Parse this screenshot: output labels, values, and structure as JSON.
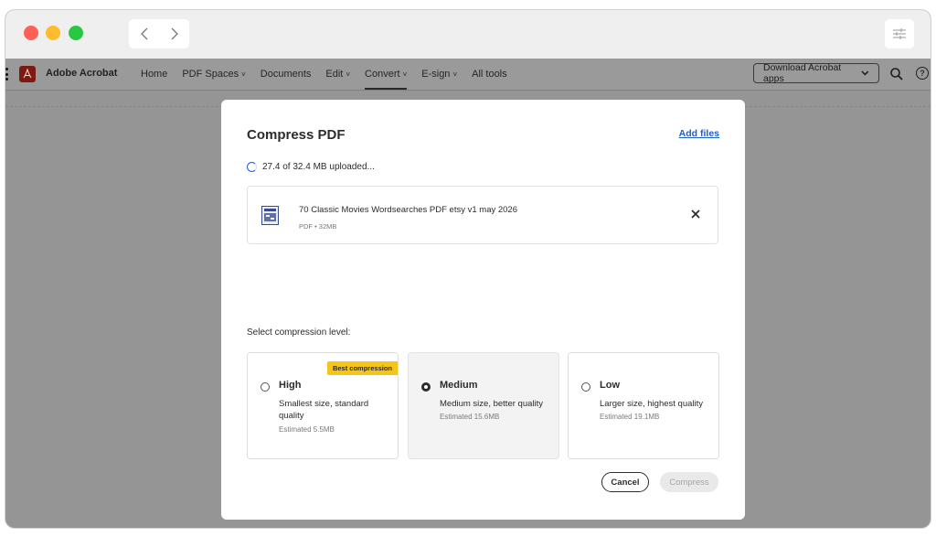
{
  "app": {
    "name": "Adobe Acrobat",
    "menu": [
      {
        "label": "Home",
        "caret": ""
      },
      {
        "label": "PDF Spaces",
        "caret": "˅"
      },
      {
        "label": "Documents",
        "caret": ""
      },
      {
        "label": "Edit",
        "caret": "˅"
      },
      {
        "label": "Convert",
        "caret": "˅"
      },
      {
        "label": "E-sign",
        "caret": "˅"
      },
      {
        "label": "All tools",
        "caret": ""
      }
    ],
    "active_menu": "Convert",
    "download_label": "Download Acrobat apps",
    "help_glyph": "?"
  },
  "modal": {
    "title": "Compress PDF",
    "add_files": "Add files",
    "upload_status": "27.4 of 32.4 MB uploaded...",
    "file": {
      "name": "70 Classic Movies Wordsearches PDF etsy v1 may 2026",
      "meta": "PDF • 32MB"
    },
    "level_label": "Select compression level:",
    "options": [
      {
        "title": "High",
        "desc": "Smallest size, standard quality",
        "estimate": "Estimated 5.5MB",
        "badge": "Best compression",
        "selected": false
      },
      {
        "title": "Medium",
        "desc": "Medium size, better quality",
        "estimate": "Estimated 15.6MB",
        "badge": "",
        "selected": true
      },
      {
        "title": "Low",
        "desc": "Larger size, highest quality",
        "estimate": "Estimated 19.1MB",
        "badge": "",
        "selected": false
      }
    ],
    "cancel": "Cancel",
    "compress": "Compress"
  },
  "colors": {
    "accent_link": "#1f5fc8",
    "badge": "#f5c518",
    "overlay": "#959595",
    "acrobat_red": "#7a1a10"
  },
  "icons": [
    "back-arrow-icon",
    "forward-arrow-icon",
    "sliders-icon",
    "acrobat-logo-icon",
    "chevron-down-icon",
    "search-icon",
    "help-icon",
    "pdf-file-icon",
    "close-icon"
  ]
}
